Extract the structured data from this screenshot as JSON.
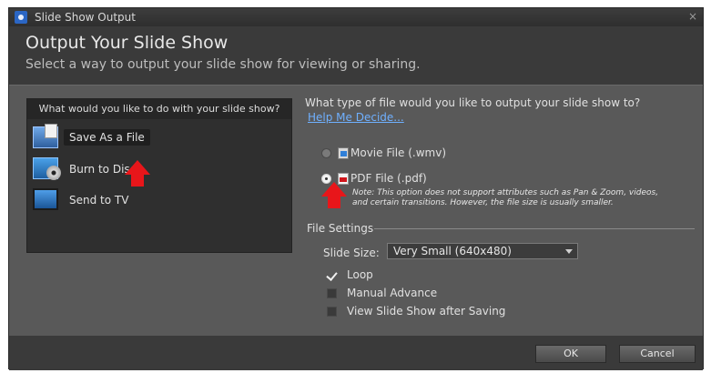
{
  "window": {
    "title": "Slide Show Output",
    "close_glyph": "×"
  },
  "header": {
    "title": "Output Your Slide Show",
    "subtitle": "Select a way to output your slide show for viewing or sharing."
  },
  "left_panel": {
    "heading": "What would you like to do with your slide show?",
    "options": [
      {
        "label": "Save As a File",
        "icon": "save-file-icon",
        "selected": true
      },
      {
        "label": "Burn to Disc",
        "icon": "disc-icon",
        "selected": false
      },
      {
        "label": "Send to TV",
        "icon": "tv-icon",
        "selected": false
      }
    ]
  },
  "file_type": {
    "question": "What type of file would you like to output your slide show to?",
    "help_link": "Help Me Decide...",
    "options": [
      {
        "label": "Movie File (.wmv)",
        "icon": "wmv-icon",
        "selected": false
      },
      {
        "label": "PDF File (.pdf)",
        "icon": "pdf-icon",
        "selected": true
      }
    ],
    "note_line1": "Note: This option does not support attributes such as Pan & Zoom, videos,",
    "note_line2": "and certain transitions. However, the file size is usually smaller."
  },
  "file_settings": {
    "label": "File Settings",
    "slide_size_label": "Slide Size:",
    "slide_size_value": "Very Small (640x480)",
    "checkboxes": [
      {
        "label": "Loop",
        "checked": true
      },
      {
        "label": "Manual Advance",
        "checked": false
      },
      {
        "label": "View Slide Show after Saving",
        "checked": false
      }
    ]
  },
  "buttons": {
    "ok": "OK",
    "cancel": "Cancel"
  },
  "colors": {
    "accent_arrow": "#e8161a",
    "link": "#6fb0ff",
    "panel": "#2f2f2f"
  }
}
